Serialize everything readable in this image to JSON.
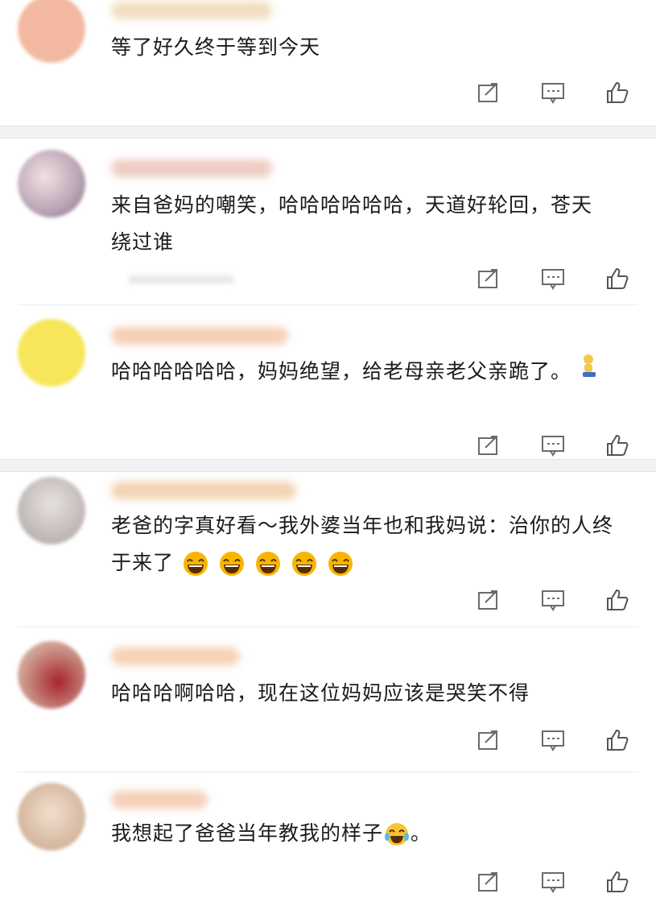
{
  "comments": [
    {
      "text": "等了好久终于等到今天",
      "avatar_color": "#f1b9a2",
      "name_color": "#f0d9b6"
    },
    {
      "text": "来自爸妈的嘲笑，哈哈哈哈哈哈，天道好轮回，苍天绕过谁",
      "avatar_color": "#c9b6c7",
      "name_color": "#e9c4b8"
    },
    {
      "text": "哈哈哈哈哈哈，妈妈绝望，给老母亲老父亲跪了。",
      "avatar_color": "#f7e65a",
      "name_color": "#f4c6a8"
    },
    {
      "text": "老爸的字真好看～我外婆当年也和我妈说：治你的人终于来了",
      "avatar_color": "#cfc8c6",
      "name_color": "#f2cba5"
    },
    {
      "text": "哈哈哈啊哈哈，现在这位妈妈应该是哭笑不得",
      "avatar_color": "#c07a78",
      "name_color": "#f4c9a8"
    },
    {
      "text": "我想起了爸爸当年教我的样子",
      "text_suffix": "。",
      "avatar_color": "#e2c9b5",
      "name_color": "#f3c7aa"
    }
  ],
  "icons": {
    "share": "share-icon",
    "comment": "comment-icon",
    "like": "thumbs-up-icon",
    "kneel": "kneeling-emoji",
    "laugh": "laughing-emoji",
    "tears": "tears-of-joy-emoji"
  }
}
